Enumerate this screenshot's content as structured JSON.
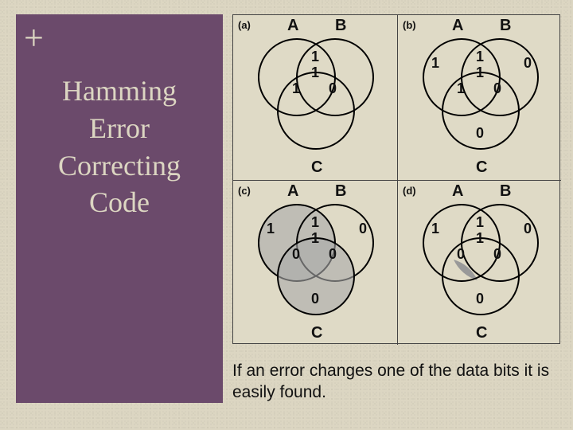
{
  "sidebar": {
    "plus": "+",
    "title_line1": "Hamming",
    "title_line2": "Error",
    "title_line3": "Correcting",
    "title_line4": "Code"
  },
  "diagram": {
    "circle_labels": {
      "A": "A",
      "B": "B",
      "C": "C"
    },
    "panels": [
      {
        "id": "(a)",
        "values": {
          "AB": "1",
          "ABC": "1",
          "AC": "1",
          "BC": "0"
        },
        "fills": {
          "A": "none",
          "B": "none",
          "C": "none"
        }
      },
      {
        "id": "(b)",
        "values": {
          "AB": "1",
          "ABC": "1",
          "AC": "1",
          "BC": "0",
          "A": "1",
          "B": "0",
          "C": "0"
        },
        "fills": {
          "A": "none",
          "B": "none",
          "C": "none"
        }
      },
      {
        "id": "(c)",
        "values": {
          "AB": "1",
          "ABC": "1",
          "AC": "0",
          "BC": "0",
          "A": "1",
          "B": "0",
          "C": "0"
        },
        "fills": {
          "A": "#aaa",
          "B": "none",
          "C": "#aaa"
        }
      },
      {
        "id": "(d)",
        "values": {
          "AB": "1",
          "ABC": "1",
          "AC": "0",
          "BC": "0",
          "A": "1",
          "B": "0",
          "C": "0"
        },
        "fills": {
          "A": "none",
          "B": "none",
          "C": "none",
          "AC_region": "#999"
        }
      }
    ]
  },
  "caption": "If an error changes one of the data bits it is easily found."
}
